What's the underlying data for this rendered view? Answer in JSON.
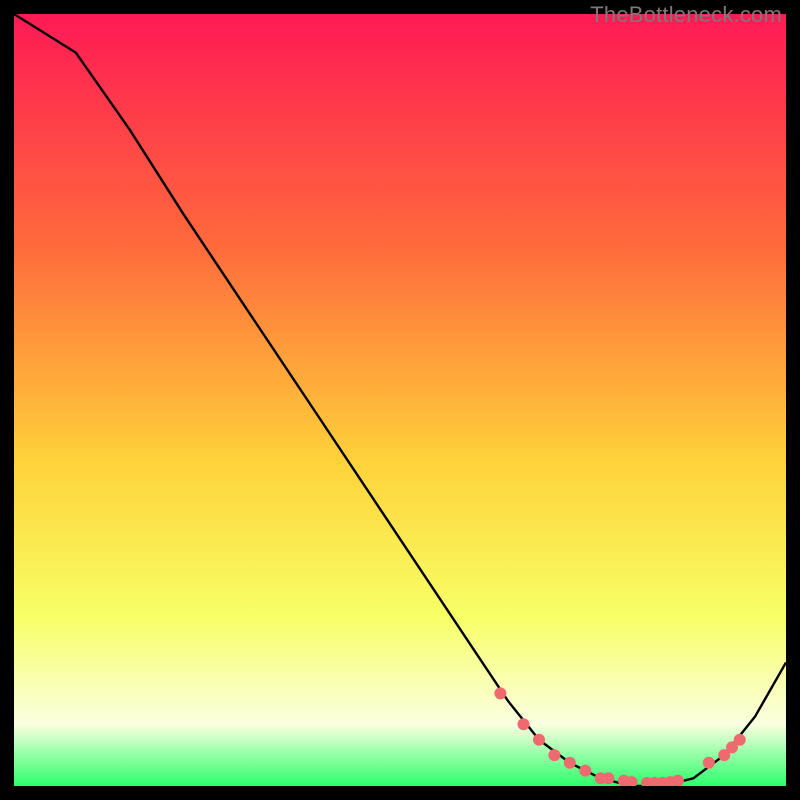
{
  "watermark": "TheBottleneck.com",
  "colors": {
    "black": "#000000",
    "grad_top": "#ff1a55",
    "grad_upper_mid": "#ff6a3c",
    "grad_mid": "#ffd23a",
    "grad_lower_mid": "#f8ff66",
    "grad_low": "#faffe0",
    "grad_bottom": "#2cff6b",
    "line": "#000000",
    "dot": "#ee6a6e"
  },
  "chart_data": {
    "type": "line",
    "title": "",
    "xlabel": "",
    "ylabel": "",
    "xlim": [
      0,
      100
    ],
    "ylim": [
      0,
      100
    ],
    "grid": false,
    "legend": false,
    "series": [
      {
        "name": "bottleneck-curve",
        "x": [
          0,
          8,
          15,
          22,
          30,
          38,
          46,
          54,
          60,
          64,
          68,
          72,
          76,
          80,
          84,
          88,
          92,
          96,
          100
        ],
        "y": [
          100,
          95,
          85,
          74,
          62,
          50,
          38,
          26,
          17,
          11,
          6,
          3,
          1,
          0,
          0,
          1,
          4,
          9,
          16
        ]
      }
    ],
    "dots": {
      "name": "highlighted-points",
      "x": [
        63,
        66,
        68,
        70,
        72,
        74,
        76,
        77,
        79,
        80,
        82,
        83,
        84,
        85,
        86,
        90,
        92,
        93,
        94
      ],
      "y": [
        12,
        8,
        6,
        4,
        3,
        2,
        1,
        1,
        0.7,
        0.5,
        0.4,
        0.4,
        0.4,
        0.5,
        0.7,
        3,
        4,
        5,
        6
      ]
    }
  }
}
